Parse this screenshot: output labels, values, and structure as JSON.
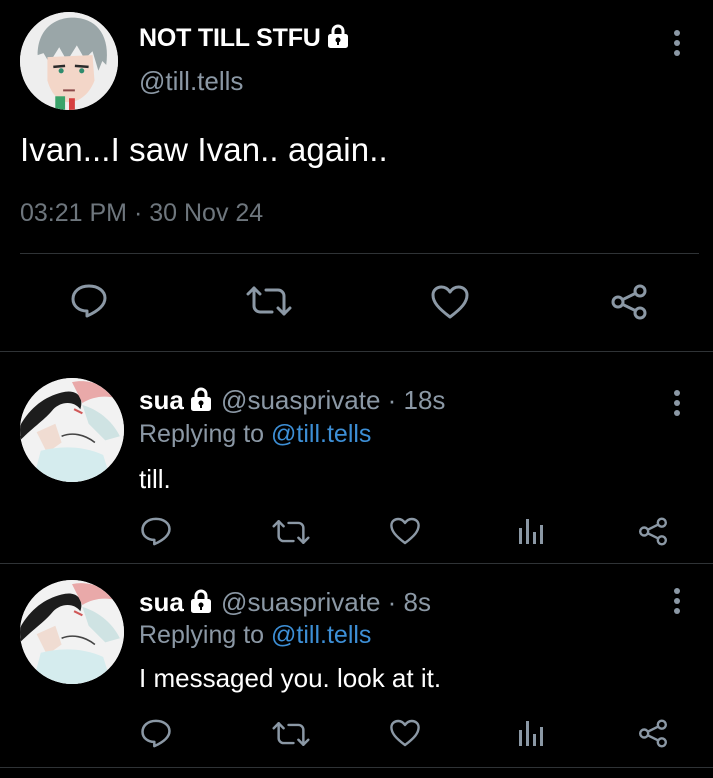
{
  "main_tweet": {
    "author_name": "NOT TILL STFU",
    "author_handle": "@till.tells",
    "text": "Ivan...I saw Ivan.. again..",
    "time": "03:21 PM",
    "separator": " · ",
    "date": "30 Nov 24",
    "icons": [
      "reply-icon",
      "retweet-icon",
      "like-icon",
      "share-icon"
    ]
  },
  "replies": [
    {
      "author_name": "sua",
      "author_handle": "@suasprivate",
      "separator": " · ",
      "time": "18s",
      "replying_prefix": "Replying to ",
      "replying_handle": "@till.tells",
      "text": "till."
    },
    {
      "author_name": "sua",
      "author_handle": "@suasprivate",
      "separator": " · ",
      "time": "8s",
      "replying_prefix": "Replying to ",
      "replying_handle": "@till.tells",
      "text": "I messaged you. look at it."
    }
  ],
  "colors": {
    "background": "#000000",
    "primary_text": "#ffffff",
    "secondary_text": "#8b98a5",
    "link": "#3d8fd6",
    "divider": "#2f3336"
  }
}
